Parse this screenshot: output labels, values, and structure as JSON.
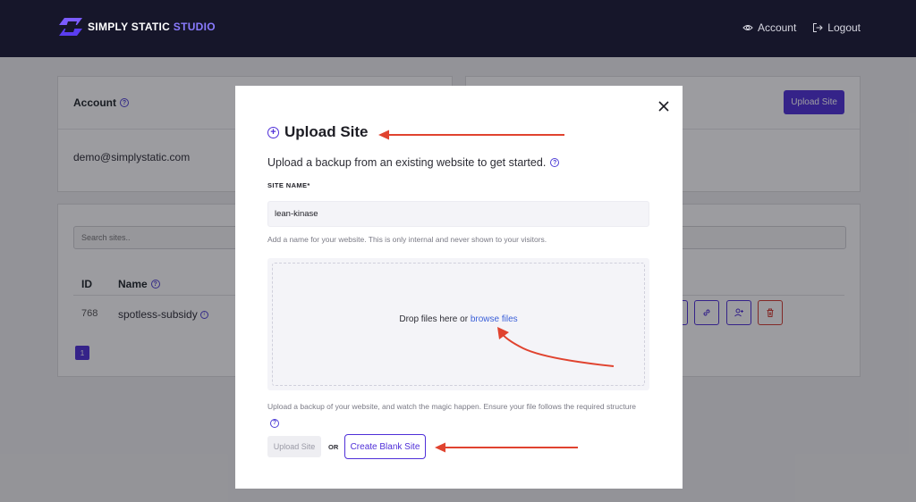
{
  "brand": {
    "name_main": "SIMPLY STATIC",
    "name_accent": "STUDIO"
  },
  "top_nav": {
    "account": "Account",
    "logout": "Logout"
  },
  "background": {
    "account_title": "Account",
    "account_email": "demo@simplystatic.com",
    "upload_site_button": "Upload Site",
    "search_placeholder": "Search sites..",
    "table_headers": {
      "id": "ID",
      "name": "Name"
    },
    "rows": [
      {
        "id": "768",
        "name": "spotless-subsidy"
      }
    ],
    "pagination_current": "1"
  },
  "modal": {
    "title": "Upload Site",
    "subtitle": "Upload a backup from an existing website to get started.",
    "site_name_label": "SITE NAME*",
    "site_name_value": "lean-kinase",
    "site_name_help": "Add a name for your website. This is only internal and never shown to your visitors.",
    "drop_text": "Drop files here or",
    "drop_link": "browse files",
    "drop_help": "Upload a backup of your website, and watch the magic happen. Ensure your file follows the required structure",
    "upload_button": "Upload Site",
    "or_text": "OR",
    "blank_site_button": "Create Blank Site"
  },
  "colors": {
    "brand_purple": "#4f2fd8",
    "annotation_red": "#e0432f",
    "topbar": "#16162a"
  }
}
